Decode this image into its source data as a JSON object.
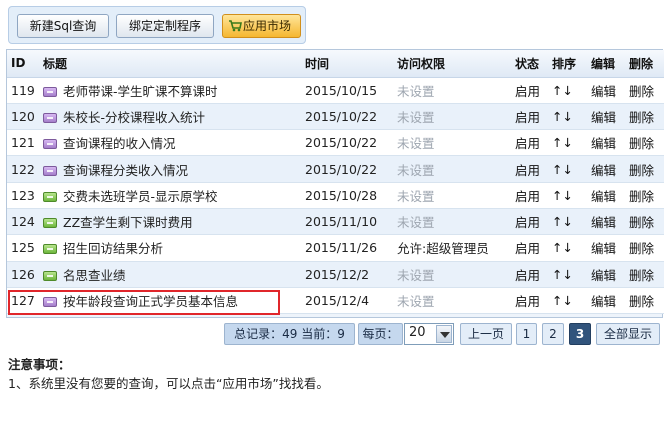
{
  "toolbar": {
    "new_sql": "新建Sql查询",
    "bind_program": "绑定定制程序",
    "app_market": "应用市场"
  },
  "table": {
    "headers": {
      "id": "ID",
      "title": "标题",
      "time": "时间",
      "access": "访问权限",
      "status": "状态",
      "sort": "排序",
      "edit": "编辑",
      "delete": "删除"
    },
    "rows": [
      {
        "id": "119",
        "icon": "purple",
        "title": "老师带课-学生旷课不算课时",
        "time": "2015/10/15",
        "access": "未设置",
        "status": "启用",
        "sort": "↑↓",
        "edit": "编辑",
        "delete": "删除"
      },
      {
        "id": "120",
        "icon": "purple",
        "title": "朱校长-分校课程收入统计",
        "time": "2015/10/22",
        "access": "未设置",
        "status": "启用",
        "sort": "↑↓",
        "edit": "编辑",
        "delete": "删除"
      },
      {
        "id": "121",
        "icon": "purple",
        "title": "查询课程的收入情况",
        "time": "2015/10/22",
        "access": "未设置",
        "status": "启用",
        "sort": "↑↓",
        "edit": "编辑",
        "delete": "删除"
      },
      {
        "id": "122",
        "icon": "purple",
        "title": "查询课程分类收入情况",
        "time": "2015/10/22",
        "access": "未设置",
        "status": "启用",
        "sort": "↑↓",
        "edit": "编辑",
        "delete": "删除"
      },
      {
        "id": "123",
        "icon": "green",
        "title": "交费未选班学员-显示原学校",
        "time": "2015/10/28",
        "access": "未设置",
        "status": "启用",
        "sort": "↑↓",
        "edit": "编辑",
        "delete": "删除"
      },
      {
        "id": "124",
        "icon": "green",
        "title": "ZZ查学生剩下课时费用",
        "time": "2015/11/10",
        "access": "未设置",
        "status": "启用",
        "sort": "↑↓",
        "edit": "编辑",
        "delete": "删除"
      },
      {
        "id": "125",
        "icon": "green",
        "title": "招生回访结果分析",
        "time": "2015/11/26",
        "access": "允许:超级管理员",
        "status": "启用",
        "sort": "↑↓",
        "edit": "编辑",
        "delete": "删除"
      },
      {
        "id": "126",
        "icon": "green",
        "title": "名思查业绩",
        "time": "2015/12/2",
        "access": "未设置",
        "status": "启用",
        "sort": "↑↓",
        "edit": "编辑",
        "delete": "删除"
      },
      {
        "id": "127",
        "icon": "purple",
        "title": "按年龄段查询正式学员基本信息",
        "time": "2015/12/4",
        "access": "未设置",
        "status": "启用",
        "sort": "↑↓",
        "edit": "编辑",
        "delete": "删除"
      }
    ]
  },
  "pager": {
    "summary": "总记录：49 当前：9",
    "per_page_label": "每页：",
    "per_page_value": "20",
    "prev": "上一页",
    "pages": [
      "1",
      "2",
      "3"
    ],
    "current_page": "3",
    "show_all": "全部显示"
  },
  "notes": {
    "title": "注意事项：",
    "line1": "1、系统里没有您要的查询，可以点击“应用市场”找找看。"
  },
  "colors": {
    "highlight": "#e0262b",
    "accent": "#31547c"
  }
}
